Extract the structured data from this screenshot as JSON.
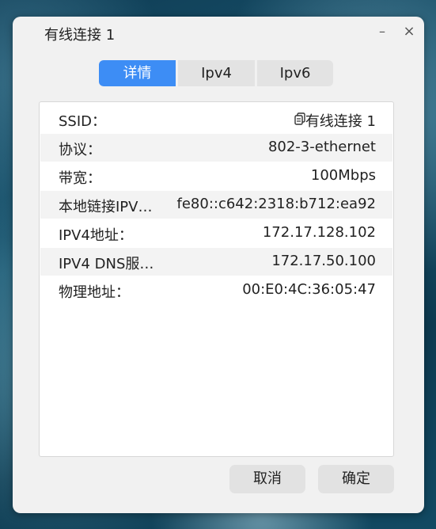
{
  "window": {
    "title": "有线连接 1",
    "minimize_symbol": "–",
    "close_symbol": "×"
  },
  "tabs": [
    {
      "label": "详情",
      "active": true
    },
    {
      "label": "Ipv4",
      "active": false
    },
    {
      "label": "Ipv6",
      "active": false
    }
  ],
  "details": [
    {
      "label": "SSID：",
      "value": "有线连接 1",
      "icon": "copy-icon"
    },
    {
      "label": "协议：",
      "value": "802-3-ethernet"
    },
    {
      "label": "带宽：",
      "value": "100Mbps"
    },
    {
      "label": "本地链接IPV…",
      "value": "fe80::c642:2318:b712:ea92"
    },
    {
      "label": "IPV4地址：",
      "value": "172.17.128.102"
    },
    {
      "label": "IPV4 DNS服…",
      "value": "172.17.50.100"
    },
    {
      "label": "物理地址：",
      "value": "00:E0:4C:36:05:47"
    }
  ],
  "buttons": {
    "cancel": "取消",
    "ok": "确定"
  },
  "colors": {
    "accent": "#3d8df5",
    "dialog_bg": "#f1f1f1",
    "panel_bg": "#ffffff",
    "row_alt": "#f3f3f3"
  }
}
